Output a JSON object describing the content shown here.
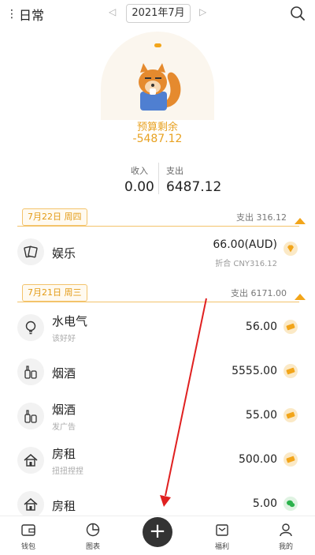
{
  "header": {
    "book_name": "日常",
    "menu_icon": "vertical-dots-icon",
    "month": "2021年7月",
    "prev_icon": "chevron-left-icon",
    "next_icon": "chevron-right-icon",
    "search_icon": "search-icon"
  },
  "summary": {
    "budget_label": "预算剩余",
    "budget_value": "-5487.12",
    "income_label": "收入",
    "income_value": "0.00",
    "expense_label": "支出",
    "expense_value": "6487.12"
  },
  "days": [
    {
      "date": "7月22日 周四",
      "total": "支出 316.12",
      "entries": [
        {
          "category": "娱乐",
          "note": "",
          "amount": "66.00(AUD)",
          "sub": "折合 CNY316.12",
          "icon": "cards-icon"
        }
      ]
    },
    {
      "date": "7月21日 周三",
      "total": "支出 6171.00",
      "entries": [
        {
          "category": "水电气",
          "note": "该好好",
          "amount": "56.00",
          "sub": "",
          "icon": "lightbulb-icon"
        },
        {
          "category": "烟酒",
          "note": "",
          "amount": "5555.00",
          "sub": "",
          "icon": "bottles-icon"
        },
        {
          "category": "烟酒",
          "note": "发广告",
          "amount": "55.00",
          "sub": "",
          "icon": "bottles-icon"
        },
        {
          "category": "房租",
          "note": "扭扭捏捏",
          "amount": "500.00",
          "sub": "",
          "icon": "house-icon"
        },
        {
          "category": "房租",
          "note": "",
          "amount": "5.00",
          "sub": "",
          "icon": "house-icon"
        }
      ]
    }
  ],
  "tabs": [
    {
      "label": "钱包",
      "icon": "wallet-icon"
    },
    {
      "label": "图表",
      "icon": "pie-chart-icon"
    },
    {
      "label": "福利",
      "icon": "gift-icon"
    },
    {
      "label": "我的",
      "icon": "user-icon"
    }
  ],
  "add_button_icon": "plus-icon",
  "colors": {
    "accent": "#f2a51a",
    "budget": "#e8a222",
    "annotation_arrow": "#e02020"
  }
}
